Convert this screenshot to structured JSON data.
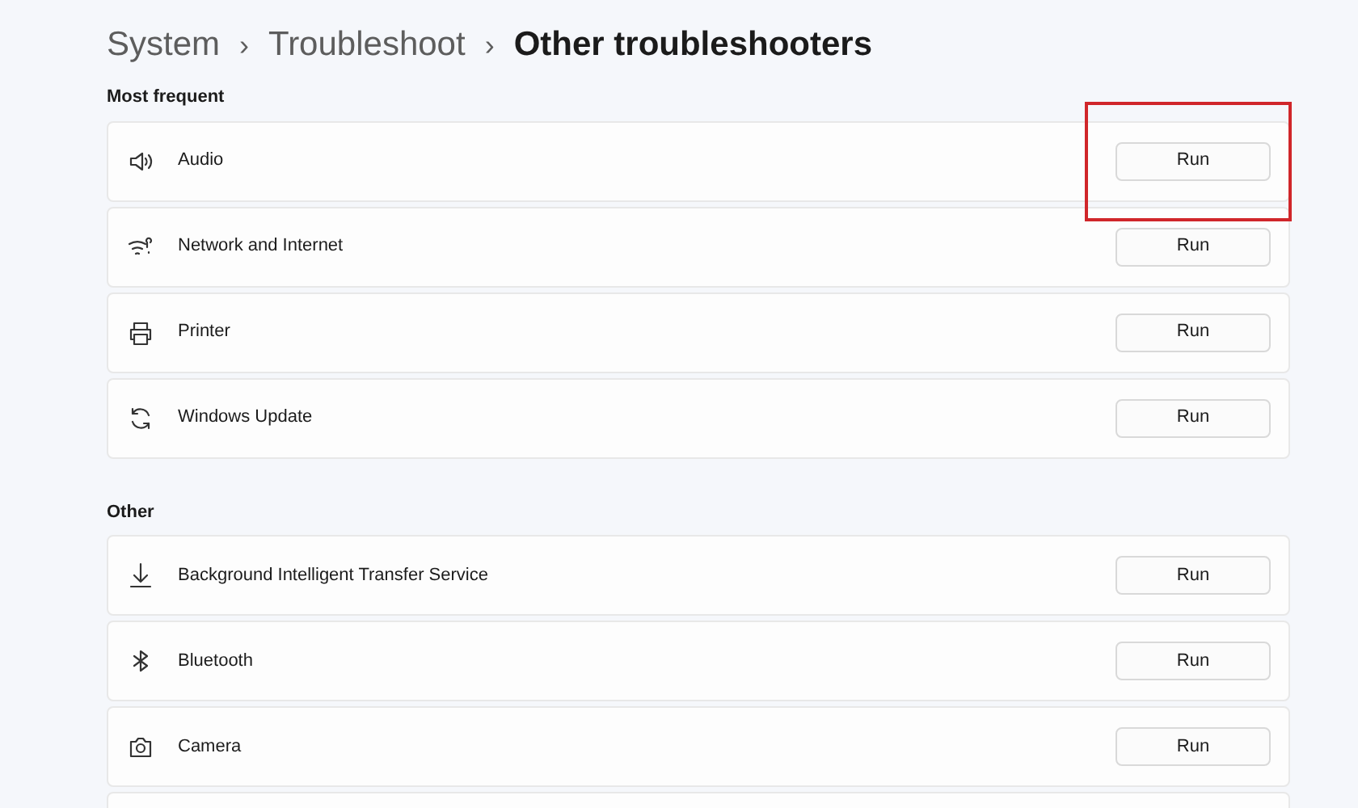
{
  "breadcrumb": [
    {
      "label": "System",
      "current": false
    },
    {
      "label": "Troubleshoot",
      "current": false
    },
    {
      "label": "Other troubleshooters",
      "current": true
    }
  ],
  "separator": "›",
  "sections": [
    {
      "heading": "Most frequent",
      "items": [
        {
          "label": "Audio",
          "button": "Run",
          "highlighted": true
        },
        {
          "label": "Network and Internet",
          "button": "Run",
          "highlighted": false
        },
        {
          "label": "Printer",
          "button": "Run",
          "highlighted": false
        },
        {
          "label": "Windows Update",
          "button": "Run",
          "highlighted": false
        }
      ]
    },
    {
      "heading": "Other",
      "items": [
        {
          "label": "Background Intelligent Transfer Service",
          "button": "Run",
          "highlighted": false
        },
        {
          "label": "Bluetooth",
          "button": "Run",
          "highlighted": false
        },
        {
          "label": "Camera",
          "button": "Run",
          "highlighted": false
        }
      ]
    }
  ]
}
